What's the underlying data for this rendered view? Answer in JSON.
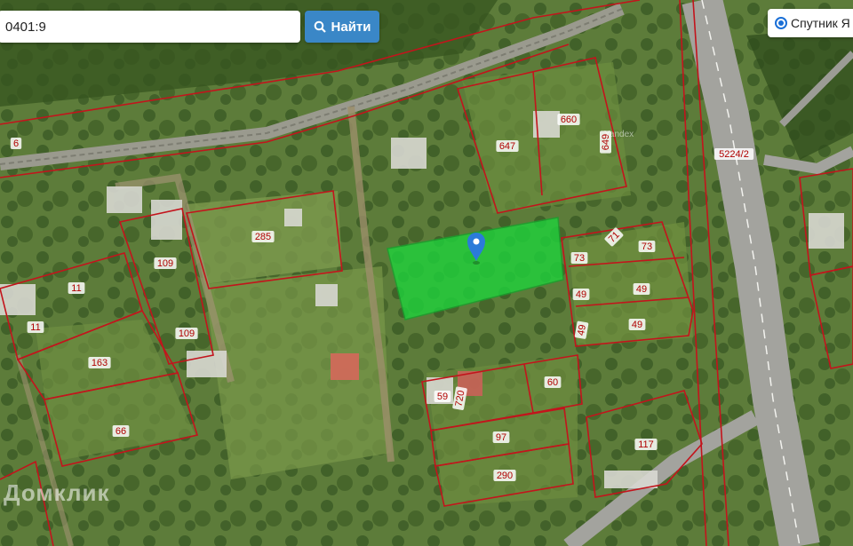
{
  "search": {
    "value": "0401:9",
    "button_label": "Найти"
  },
  "layer": {
    "label": "Спутник Я"
  },
  "watermark": "Домклик",
  "provider_mark": "Yandex",
  "plot_labels": [
    "6",
    "647",
    "660",
    "649",
    "5224/2",
    "285",
    "109",
    "109",
    "11",
    "11",
    "163",
    "66",
    "73",
    "71",
    "73",
    "49",
    "49",
    "49",
    "49",
    "59",
    "720",
    "60",
    "97",
    "290",
    "117"
  ],
  "colors": {
    "selected_plot": "#1fd33c",
    "boundary": "#c3141c",
    "search_button": "#3a87c7",
    "marker": "#2b7bd9"
  }
}
